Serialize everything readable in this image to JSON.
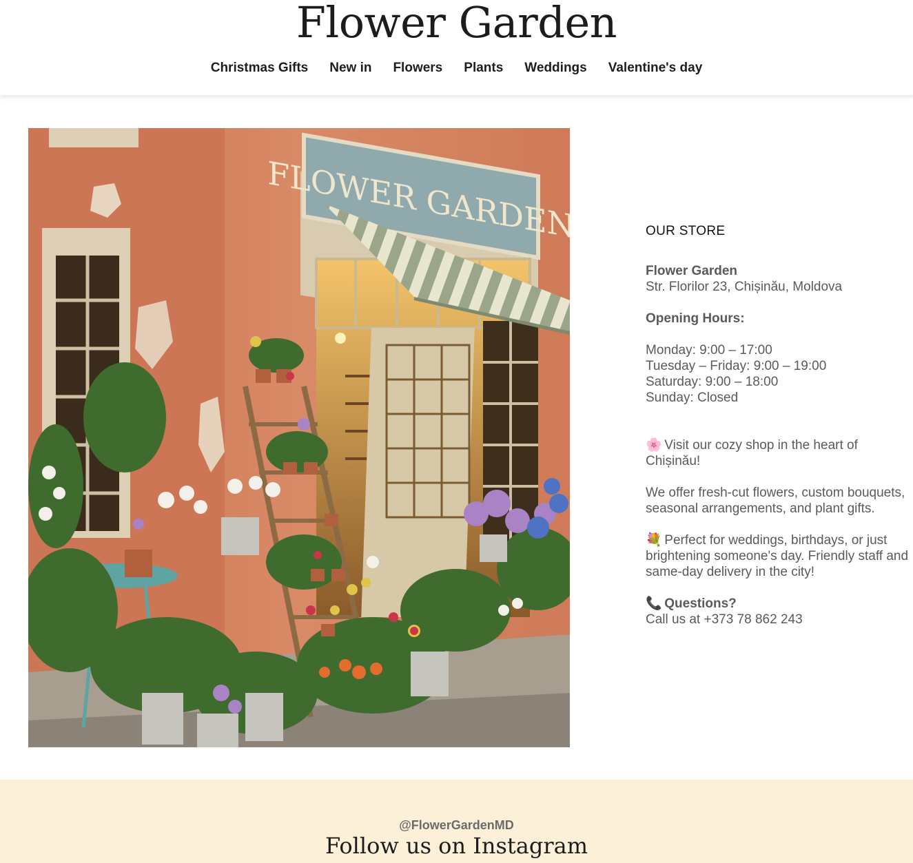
{
  "header": {
    "brand": "Flower Garden",
    "nav": [
      "Christmas Gifts",
      "New in",
      "Flowers",
      "Plants",
      "Weddings",
      "Valentine's day"
    ]
  },
  "hero_image": {
    "sign_text": "FLOWER GARDEN"
  },
  "store": {
    "heading": "OUR STORE",
    "name": "Flower Garden",
    "address": "Str. Florilor 23, Chișinău, Moldova",
    "hours_title": "Opening Hours:",
    "hours": [
      "Monday: 9:00 – 17:00",
      "Tuesday – Friday: 9:00 – 19:00",
      "Saturday: 9:00 – 18:00",
      "Sunday: Closed"
    ],
    "visit_emoji": "🌸",
    "visit_text": "Visit our cozy shop in the heart of Chișinău!",
    "offer_text": "We offer fresh-cut flowers, custom bouquets, seasonal arrangements, and plant gifts.",
    "perfect_emoji": "💐",
    "perfect_text": "Perfect for weddings, birthdays, or just brightening someone's day. Friendly staff and same-day delivery in the city!",
    "questions_emoji": "📞",
    "questions_title": "Questions?",
    "call_text": "Call us at +373 78 862 243"
  },
  "instagram": {
    "handle": "@FlowerGardenMD",
    "title": "Follow us on Instagram"
  },
  "colors": {
    "footer_bg": "#fdf0d8",
    "wall": "#d9825f",
    "sign": "#8fa9ad"
  }
}
